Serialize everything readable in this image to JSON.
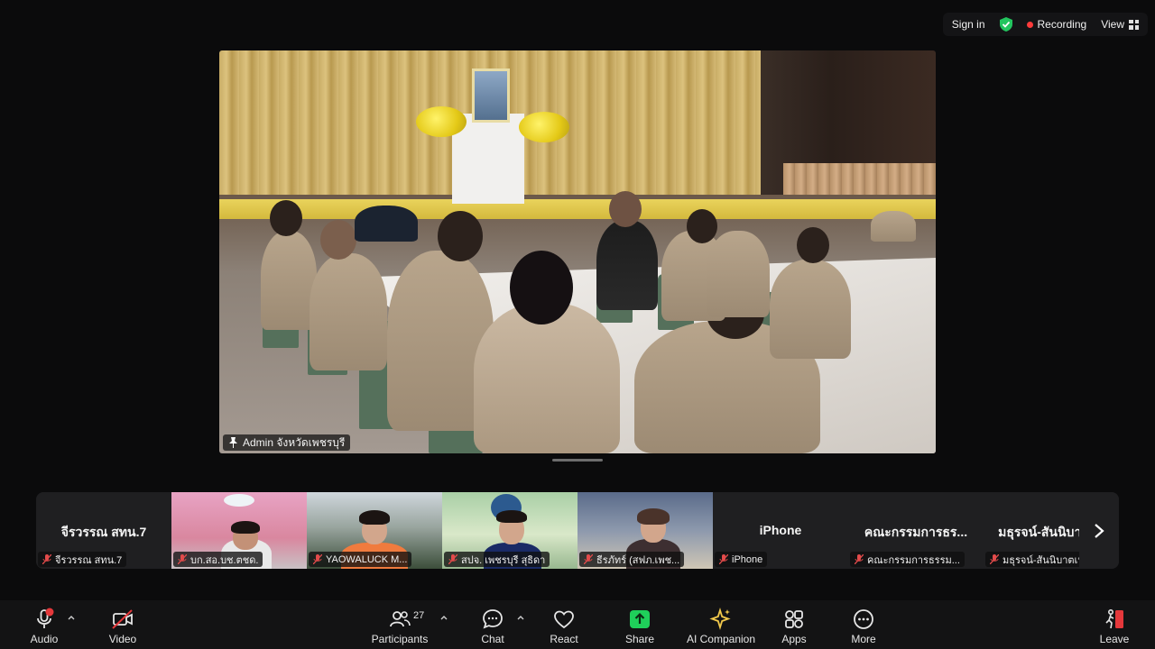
{
  "topbar": {
    "signin_label": "Sign in",
    "recording_label": "Recording",
    "view_label": "View"
  },
  "main_video": {
    "speaker_name": "Admin จังหวัดเพชรบุรี"
  },
  "participants_strip": [
    {
      "display": "จีรวรรณ สทน.7",
      "tag": "จีรวรรณ สทน.7",
      "video": false
    },
    {
      "display": "",
      "tag": "บก.สอ.บช.ตชด.",
      "video": true
    },
    {
      "display": "",
      "tag": "YAOWALUCK M...",
      "video": true
    },
    {
      "display": "",
      "tag": "สปจ. เพชรบุรี สุธิดา",
      "video": true
    },
    {
      "display": "",
      "tag": "ธีรภัทร์ (สฟภ.เพช...",
      "video": true
    },
    {
      "display": "iPhone",
      "tag": "iPhone",
      "video": false
    },
    {
      "display": "คณะกรรมการธร...",
      "tag": "คณะกรรมการธรรม...",
      "video": false
    },
    {
      "display": "มธุรจน์-สันนิบาตเ...",
      "tag": "มธุรจน์-สันนิบาตเห...",
      "video": false
    }
  ],
  "toolbar": {
    "audio_label": "Audio",
    "video_label": "Video",
    "participants_label": "Participants",
    "participants_count": "27",
    "chat_label": "Chat",
    "react_label": "React",
    "share_label": "Share",
    "ai_companion_label": "AI Companion",
    "apps_label": "Apps",
    "more_label": "More",
    "leave_label": "Leave"
  },
  "colors": {
    "background": "#0b0b0c",
    "share_green": "#1fcf5a",
    "recording_red": "#ff3b3b",
    "leave_red": "#e5383b",
    "ai_gold": "#f2c94c"
  }
}
